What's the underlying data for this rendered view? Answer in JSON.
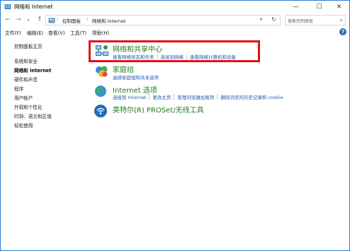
{
  "window": {
    "title": "网络和 Internet",
    "icon": "network-folder-icon",
    "buttons": {
      "minimize": "—",
      "maximize": "☐",
      "close": "✕"
    }
  },
  "address": {
    "nav": {
      "back": "←",
      "forward": "→",
      "recent": "▾",
      "up": "↑"
    },
    "crumbs": [
      "控制面板",
      "网络和 Internet"
    ],
    "crumb_separator": "›",
    "dropdown": "▾",
    "refresh": "↻",
    "search_placeholder": "搜索控制面板",
    "search_icon": "⌕"
  },
  "menu": {
    "items": [
      "文件(F)",
      "编辑(E)",
      "查看(V)",
      "工具(T)",
      "帮助(H)"
    ],
    "help_button": "?"
  },
  "sidebar": {
    "items": [
      {
        "label": "控制面板主页"
      },
      {
        "label": "系统和安全"
      },
      {
        "label": "网络和 Internet"
      },
      {
        "label": "硬件和声音"
      },
      {
        "label": "程序"
      },
      {
        "label": "用户帐户"
      },
      {
        "label": "外观和个性化"
      },
      {
        "label": "时钟、语言和区域"
      },
      {
        "label": "轻松使用"
      }
    ],
    "current_index": 2
  },
  "categories": [
    {
      "title": "网络和共享中心",
      "icon": "network-sharing-center-icon",
      "links": [
        "查看网络状态和任务",
        "连接到网络",
        "查看网络计算机和设备"
      ],
      "highlighted": true
    },
    {
      "title": "家庭组",
      "icon": "homegroup-icon",
      "links": [
        "选择家庭组和共享选项"
      ],
      "highlighted": false
    },
    {
      "title": "Internet 选项",
      "icon": "internet-options-icon",
      "links": [
        "连接到 Internet",
        "更改主页",
        "管理浏览器加载项",
        "删除浏览的历史记录和 cookie"
      ],
      "highlighted": false
    },
    {
      "title": "英特尔(R) PROSet/无线工具",
      "icon": "intel-wireless-icon",
      "links": [],
      "highlighted": false
    }
  ],
  "colors": {
    "category_title": "#1e7d1e",
    "link": "#1f5da8",
    "highlight_border": "#e3101a",
    "window_border": "#2b7bd1"
  }
}
